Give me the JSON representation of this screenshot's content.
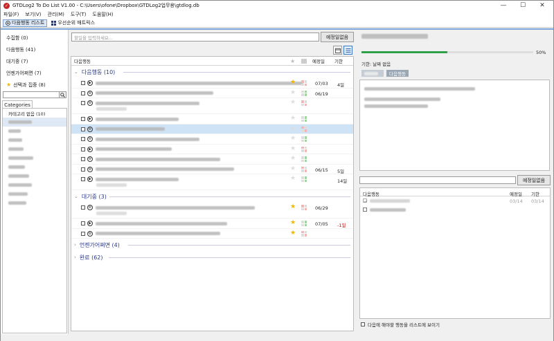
{
  "window": {
    "title": "GTDLog2 To Do List V1.00 - C:\\Users\\ofone\\Dropbox\\GTDLog2업무용\\gtdlog.db",
    "minimize": "—",
    "maximize": "☐",
    "close": "✕"
  },
  "menu": [
    "파일(F)",
    "보기(V)",
    "관리(M)",
    "도구(T)",
    "도움말(H)"
  ],
  "toolbar": {
    "next_actions_list": "다음행동 리스트",
    "priority_matrix": "우선순위 매트릭스"
  },
  "left": {
    "items": [
      {
        "label": "수집함 (0)"
      },
      {
        "label": "다음행동 (41)"
      },
      {
        "label": "대기중 (7)"
      },
      {
        "label": "언젠가어쩌면 (7)"
      },
      {
        "label": "선택과 집중 (8)",
        "icon": "star-icon"
      }
    ],
    "categories_tab": "Categories",
    "category_first": "카테고리 없음 (10)"
  },
  "center": {
    "input_placeholder": "할일을 입력하세요...",
    "add_button": "예정일없음",
    "columns": {
      "name": "다음행동",
      "date": "예정일",
      "due": "기한"
    },
    "groups": {
      "next": "다음행동 (10)",
      "waiting": "대기중 (3)",
      "someday": "언젠가어쩌면 (4)",
      "done": "완료 (62)"
    },
    "next_rows": [
      {
        "star": true,
        "date": "07/03",
        "due": "4일",
        "due_red": false
      },
      {
        "star": false,
        "date": "06/19",
        "due": "",
        "due_red": false
      },
      {
        "star": false,
        "date": "",
        "due": "",
        "due_red": false
      },
      {
        "star": false,
        "date": "",
        "due": "",
        "due_red": false
      },
      {
        "star": false,
        "date": "",
        "due": "",
        "due_red": false
      },
      {
        "star": false,
        "date": "",
        "due": "",
        "due_red": false
      },
      {
        "star": false,
        "date": "",
        "due": "",
        "due_red": false
      },
      {
        "star": false,
        "date": "",
        "due": "",
        "due_red": false
      },
      {
        "star": false,
        "date": "06/15",
        "due": "5일",
        "due_red": false
      },
      {
        "star": false,
        "date": "",
        "due": "14일",
        "due_red": false
      }
    ],
    "waiting_rows": [
      {
        "star": true,
        "date": "06/29",
        "due": "",
        "due_red": false
      },
      {
        "star": true,
        "date": "07/05",
        "due": "-1일",
        "due_red": true
      },
      {
        "star": true,
        "date": "",
        "due": "",
        "due_red": false
      }
    ]
  },
  "right": {
    "progress_percent": 50,
    "progress_label": "50%",
    "due_text": "기한: 날짜 없음",
    "tag_label": "다음행동",
    "add_button": "예정일없음",
    "subtable_columns": {
      "name": "다음행동",
      "date": "예정일",
      "due": "기한"
    },
    "subrows": [
      {
        "checked": true,
        "date": "03/14",
        "due": "03/14"
      },
      {
        "checked": false,
        "date": "",
        "due": ""
      }
    ],
    "footer_checkbox": "다음에 해야할 행동을 리스트에 보이기"
  },
  "colors": {
    "accent": "#3a78c4",
    "group_text": "#2a3a8a",
    "progress": "#2fa04a",
    "star": "#f2b600",
    "due_red": "#d00000"
  }
}
